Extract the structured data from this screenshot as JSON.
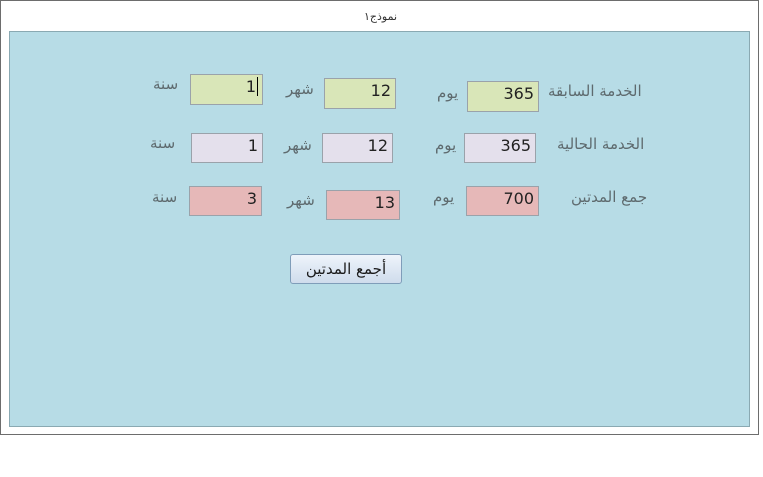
{
  "window": {
    "tab_title": "نموذج١"
  },
  "rows": [
    {
      "label": "الخدمة السابقة",
      "day_value": "365",
      "day_unit": "يوم",
      "month_value": "12",
      "month_unit": "شهر",
      "year_value": "1",
      "year_unit": "سنة"
    },
    {
      "label": "الخدمة الحالية",
      "day_value": "365",
      "day_unit": "يوم",
      "month_value": "12",
      "month_unit": "شهر",
      "year_value": "1",
      "year_unit": "سنة"
    },
    {
      "label": "جمع المدتين",
      "day_value": "700",
      "day_unit": "يوم",
      "month_value": "13",
      "month_unit": "شهر",
      "year_value": "3",
      "year_unit": "سنة"
    }
  ],
  "button": {
    "label": "أجمع المدتين"
  },
  "colors": {
    "form_background": "#b7dce6",
    "row1_fields": "#d9e6b8",
    "row2_fields": "#e4e0ec",
    "row3_fields": "#e6b8b8"
  }
}
